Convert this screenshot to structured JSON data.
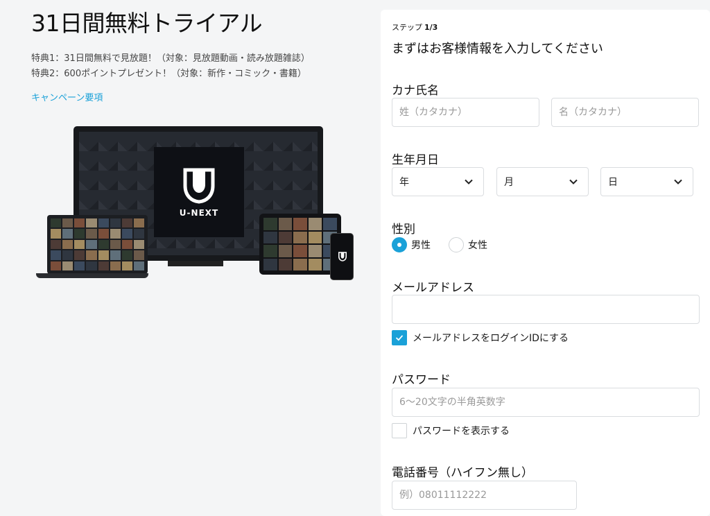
{
  "promo": {
    "title": "31日間無料トライアル",
    "perks": [
      "特典1：31日間無料で見放題！（対象：見放題動画・読み放題雑誌）",
      "特典2：600ポイントプレゼント！（対象：新作・コミック・書籍）"
    ],
    "campaign_link": "キャンペーン要項",
    "brand_name": "U-NEXT"
  },
  "colors": {
    "accent": "#1aa1d8",
    "panel_bg": "#ffffff",
    "page_bg": "#f4f5f6"
  },
  "form": {
    "step_label": "ステップ",
    "step_value": "1/3",
    "title": "まずはお客様情報を入力してください",
    "kana_name": {
      "label": "カナ氏名",
      "last_placeholder": "姓（カタカナ）",
      "first_placeholder": "名（カタカナ）"
    },
    "birthday": {
      "label": "生年月日",
      "year": "年",
      "month": "月",
      "day": "日"
    },
    "gender": {
      "label": "性別",
      "options": [
        {
          "label": "男性",
          "selected": true
        },
        {
          "label": "女性",
          "selected": false
        }
      ]
    },
    "email": {
      "label": "メールアドレス",
      "value": "",
      "login_id_checkbox": {
        "label": "メールアドレスをログインIDにする",
        "checked": true
      }
    },
    "password": {
      "label": "パスワード",
      "placeholder": "6〜20文字の半角英数字",
      "show_checkbox": {
        "label": "パスワードを表示する",
        "checked": false
      }
    },
    "phone": {
      "label": "電話番号（ハイフン無し）",
      "placeholder": "例）08011112222"
    }
  }
}
